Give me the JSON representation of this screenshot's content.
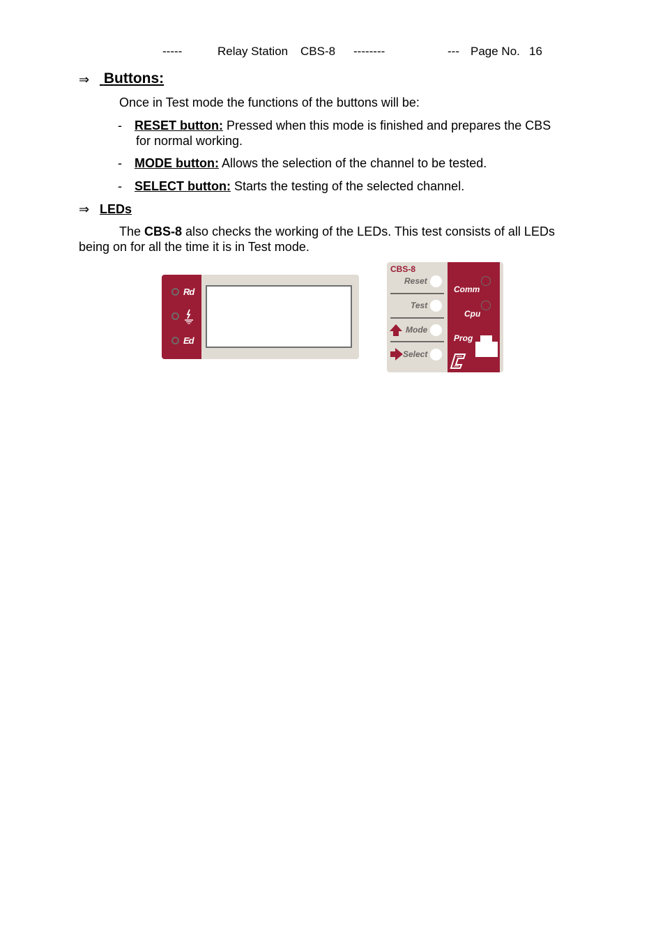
{
  "header": {
    "dash1": "-----",
    "doc_title": "Relay Station",
    "model": "CBS-8",
    "dash2": "--------",
    "dash3": "---",
    "page_label": "Page No.",
    "page_number": "16"
  },
  "sections": {
    "buttons": {
      "arrow": "⇒",
      "heading": "Buttons:",
      "intro": "Once in Test mode the functions of the buttons will be:",
      "items": [
        {
          "bullet": "-",
          "term": "RESET button:",
          "desc_line1": " Pressed when this mode is finished and prepares the CBS",
          "desc_line2": "for normal working."
        },
        {
          "bullet": "-",
          "term": "MODE button:",
          "desc_line1": " Allows the selection of the channel to be tested."
        },
        {
          "bullet": "-",
          "term": "SELECT button:",
          "desc_line1": " Starts the testing of the selected channel."
        }
      ]
    },
    "leds": {
      "arrow": "⇒",
      "heading": "LEDs",
      "para_pre": "The ",
      "para_bold": "CBS-8",
      "para_post": " also checks the working of the LEDs. This test consists of all LEDs",
      "para_line2": "being on for all the time it is in Test mode."
    }
  },
  "figure": {
    "display_panel": {
      "leds": [
        {
          "label": "Rd",
          "icon": "rd-label"
        },
        {
          "label": "",
          "icon": "lightning-ground-icon"
        },
        {
          "label": "Ed",
          "icon": "ed-label"
        }
      ]
    },
    "control_panel": {
      "title": "CBS-8",
      "buttons": [
        "Reset",
        "Test",
        "Mode",
        "Select"
      ],
      "status_leds": [
        "Comm",
        "Cpu"
      ],
      "port_label": "Prog",
      "colors": {
        "brand_red": "#9b1d35",
        "panel_grey": "#e0dcd3"
      }
    }
  }
}
